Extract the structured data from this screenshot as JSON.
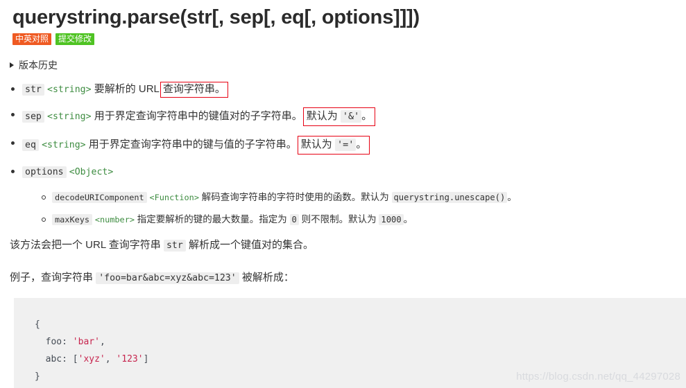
{
  "page": {
    "title": "querystring.parse(str[, sep[, eq[, options]]])"
  },
  "badges": {
    "compare_label": "中英对照",
    "compare_color": "#ef5a22",
    "submit_label": "提交修改",
    "submit_color": "#4fc323"
  },
  "history": {
    "triangle_icon": "collapsed-triangle-icon",
    "label": "版本历史"
  },
  "params": [
    {
      "name": "str",
      "type": "<string>",
      "desc_before": "要解析的 URL",
      "highlight": "查询字符串。",
      "desc_after": ""
    },
    {
      "name": "sep",
      "type": "<string>",
      "desc_before": "用于界定查询字符串中的键值对的子字符串。",
      "highlight_prefix": "默认为",
      "highlight_code": "'&'",
      "highlight_suffix": "。"
    },
    {
      "name": "eq",
      "type": "<string>",
      "desc_before": "用于界定查询字符串中的键与值的子字符串。",
      "highlight_prefix": "默认为",
      "highlight_code": "'='",
      "highlight_suffix": "。"
    },
    {
      "name": "options",
      "type": "<Object>",
      "desc_before": ""
    }
  ],
  "options_sub": [
    {
      "name": "decodeURIComponent",
      "type": "<Function>",
      "desc_before": "解码查询字符串的字符时使用的函数。默认为",
      "code": "querystring.unescape()",
      "desc_after": "。"
    },
    {
      "name": "maxKeys",
      "type": "<number>",
      "desc_before": "指定要解析的键的最大数量。指定为",
      "code": "0",
      "desc_mid": "则不限制。默认为",
      "code2": "1000",
      "desc_after": "。"
    }
  ],
  "paragraphs": {
    "p1_before": "该方法会把一个 URL 查询字符串",
    "p1_code": "str",
    "p1_after": "解析成一个键值对的集合。",
    "p2_before": "例子，查询字符串",
    "p2_code": "'foo=bar&abc=xyz&abc=123'",
    "p2_after": "被解析成："
  },
  "code_block": {
    "line1": "{",
    "line2_key": "  foo: ",
    "line2_val": "'bar'",
    "line2_end": ",",
    "line3_key": "  abc: [",
    "line3_val1": "'xyz'",
    "line3_sep": ", ",
    "line3_val2": "'123'",
    "line3_end": "]",
    "line4": "}"
  },
  "watermark": {
    "text": "https://blog.csdn.net/qq_44297028"
  }
}
